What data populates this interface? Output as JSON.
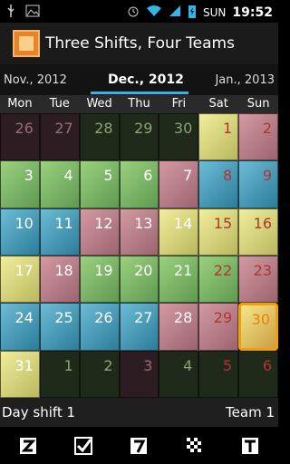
{
  "status_bar": {
    "left_icons": [
      "usb-icon",
      "image-icon"
    ],
    "right_icons": [
      "alarm-icon",
      "wifi-icon",
      "signal-icon",
      "battery-charging-icon"
    ],
    "day": "SUN",
    "time": "19:52"
  },
  "app_bar": {
    "title": "Three Shifts, Four Teams",
    "icon": "calendar-app-icon"
  },
  "month_nav": {
    "prev": "Nov., 2012",
    "current": "Dec., 2012",
    "next": "Jan., 2013",
    "accent": "#33b5e5"
  },
  "weekdays": [
    "Mon",
    "Tue",
    "Wed",
    "Thu",
    "Fri",
    "Sat",
    "Sun"
  ],
  "calendar": {
    "rows": [
      [
        {
          "day": "26",
          "shade": "dim-pink",
          "weekend": false
        },
        {
          "day": "27",
          "shade": "dim-pink",
          "weekend": false
        },
        {
          "day": "28",
          "shade": "dim-green",
          "weekend": false
        },
        {
          "day": "29",
          "shade": "dim-green",
          "weekend": false
        },
        {
          "day": "30",
          "shade": "dim-green",
          "weekend": false
        },
        {
          "day": "1",
          "shade": "yellow",
          "weekend": true
        },
        {
          "day": "2",
          "shade": "pink",
          "weekend": true
        }
      ],
      [
        {
          "day": "3",
          "shade": "green",
          "weekend": false
        },
        {
          "day": "4",
          "shade": "green",
          "weekend": false
        },
        {
          "day": "5",
          "shade": "green",
          "weekend": false
        },
        {
          "day": "6",
          "shade": "green",
          "weekend": false
        },
        {
          "day": "7",
          "shade": "pink",
          "weekend": false
        },
        {
          "day": "8",
          "shade": "blue",
          "weekend": true
        },
        {
          "day": "9",
          "shade": "blue",
          "weekend": true
        }
      ],
      [
        {
          "day": "10",
          "shade": "blue",
          "weekend": false
        },
        {
          "day": "11",
          "shade": "blue",
          "weekend": false
        },
        {
          "day": "12",
          "shade": "pink",
          "weekend": false
        },
        {
          "day": "13",
          "shade": "pink",
          "weekend": false
        },
        {
          "day": "14",
          "shade": "yellow",
          "weekend": false
        },
        {
          "day": "15",
          "shade": "yellow",
          "weekend": true
        },
        {
          "day": "16",
          "shade": "yellow",
          "weekend": true
        }
      ],
      [
        {
          "day": "17",
          "shade": "yellow",
          "weekend": false
        },
        {
          "day": "18",
          "shade": "pink",
          "weekend": false
        },
        {
          "day": "19",
          "shade": "green",
          "weekend": false
        },
        {
          "day": "20",
          "shade": "green",
          "weekend": false
        },
        {
          "day": "21",
          "shade": "green",
          "weekend": false
        },
        {
          "day": "22",
          "shade": "green",
          "weekend": true
        },
        {
          "day": "23",
          "shade": "pink",
          "weekend": true
        }
      ],
      [
        {
          "day": "24",
          "shade": "blue",
          "weekend": false
        },
        {
          "day": "25",
          "shade": "blue",
          "weekend": false
        },
        {
          "day": "26",
          "shade": "blue",
          "weekend": false
        },
        {
          "day": "27",
          "shade": "blue",
          "weekend": false
        },
        {
          "day": "28",
          "shade": "pink",
          "weekend": false
        },
        {
          "day": "29",
          "shade": "pink",
          "weekend": true
        },
        {
          "day": "30",
          "shade": "today",
          "weekend": true
        }
      ],
      [
        {
          "day": "31",
          "shade": "yellow",
          "weekend": false
        },
        {
          "day": "1",
          "shade": "dim-green",
          "weekend": false
        },
        {
          "day": "2",
          "shade": "dim-green",
          "weekend": false
        },
        {
          "day": "3",
          "shade": "dim-pink",
          "weekend": false
        },
        {
          "day": "4",
          "shade": "dim-green",
          "weekend": false
        },
        {
          "day": "5",
          "shade": "dim-green",
          "weekend": true
        },
        {
          "day": "6",
          "shade": "dim-green",
          "weekend": true
        }
      ]
    ]
  },
  "day_info": {
    "shift": "Day shift 1",
    "team": "Team 1"
  },
  "toolbar": [
    {
      "icon": "z-today-icon"
    },
    {
      "icon": "checkbox-icon"
    },
    {
      "icon": "calendar-7-icon"
    },
    {
      "icon": "grid-pattern-icon"
    },
    {
      "icon": "t-team-icon"
    }
  ]
}
